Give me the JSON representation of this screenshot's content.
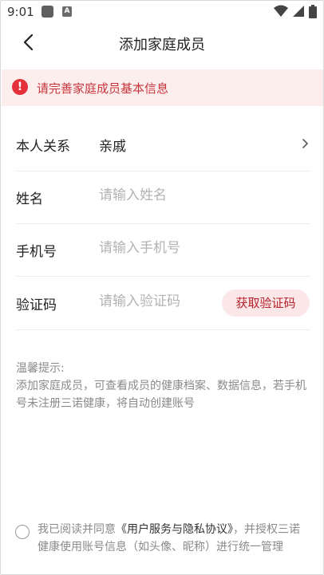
{
  "status_bar": {
    "time": "9:01",
    "notif_badge": "A"
  },
  "header": {
    "title": "添加家庭成员"
  },
  "alert": {
    "icon_glyph": "!",
    "message": "请完善家庭成员基本信息"
  },
  "form": {
    "relation": {
      "label": "本人关系",
      "value": "亲戚"
    },
    "name": {
      "label": "姓名",
      "placeholder": "请输入姓名"
    },
    "phone": {
      "label": "手机号",
      "placeholder": "请输入手机号"
    },
    "code": {
      "label": "验证码",
      "placeholder": "请输入验证码",
      "button": "获取验证码"
    }
  },
  "tips": {
    "heading": "温馨提示:",
    "body": "添加家庭成员，可查看成员的健康档案、数据信息，若手机号未注册三诺健康，将自动创建账号"
  },
  "agreement": {
    "prefix": "我已阅读并同意",
    "link": "《用户服务与隐私协议》",
    "suffix": "，并授权三诺健康使用账号信息（如头像、昵称）进行统一管理"
  },
  "colors": {
    "accent": "#c8353c",
    "alert_bg": "#fdeeee",
    "button_bg": "#fbe7e7"
  }
}
